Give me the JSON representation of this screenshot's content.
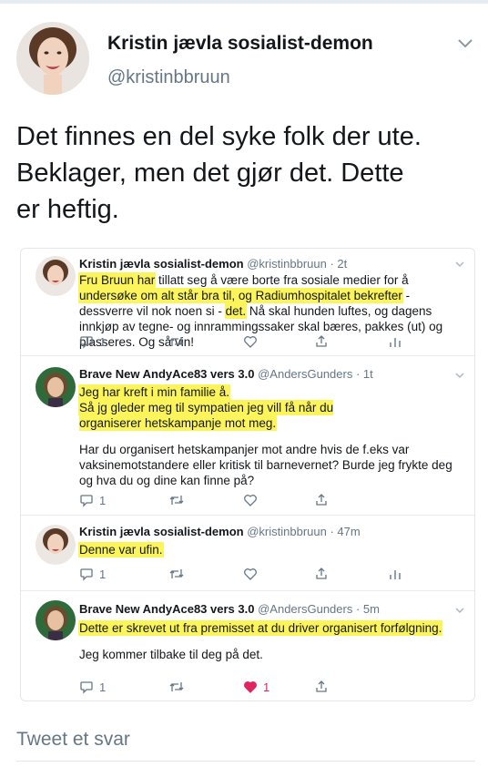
{
  "tweet": {
    "author_name": "Kristin jævla sosialist-demon",
    "author_handle": "@kristinbbruun",
    "text_lines": [
      "Det finnes en del syke folk der ute.",
      "Beklager, men det gjør det. Dette",
      "er heftig."
    ]
  },
  "embedded_replies": [
    {
      "name": "Kristin jævla sosialist-demon",
      "handle": "@kristinbbruun",
      "time": "2t",
      "h1": "Fru Bruun har",
      "t1": " tillatt seg å være borte fra sosiale medier for å ",
      "h2": "undersøke om alt står bra til, og Radiumhospitalet bekrefter",
      "t2": " - dessverre vil nok noen si - ",
      "h3": "det.",
      "t3": " Nå skal hunden luftes, og dagens innkjøp av tegne- og innrammingssaker skal bæres, pakkes (ut) og plasseres. Og så vin!",
      "reply_count": "1"
    },
    {
      "name": "Brave New AndyAce83 vers 3.0",
      "handle": "@AndersGunders",
      "time": "1t",
      "h1": "Jeg har kreft i min familie å.",
      "h2": " Så jg gleder meg til sympatien jeg vill få når du organiserer hetskampanje mot meg.",
      "p2": "Har du organisert hetskampanjer mot andre hvis de f.eks var vaksinemotstandere eller kritisk til barnevernet? Burde jeg frykte deg og hva du og dine kan finne på?",
      "reply_count": "1"
    },
    {
      "name": "Kristin jævla sosialist-demon",
      "handle": "@kristinbbruun",
      "time": "47m",
      "h1": "Denne var ufin.",
      "reply_count": "1"
    },
    {
      "name": "Brave New AndyAce83 vers 3.0",
      "handle": "@AndersGunders",
      "time": "5m",
      "h1": "Dette er skrevet ut fra premisset at du driver organisert forfølgning.",
      "p2": "Jeg kommer tilbake til deg på det.",
      "reply_count": "1",
      "like_count": "1"
    }
  ],
  "reply_placeholder": "Tweet et svar",
  "colors": {
    "highlight": "#fbf45a",
    "muted": "#657786",
    "like": "#e0245e",
    "border": "#e6ecf0"
  }
}
